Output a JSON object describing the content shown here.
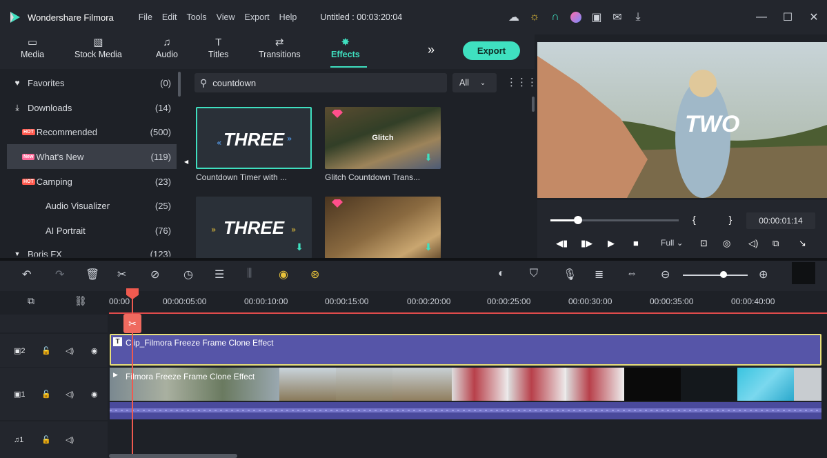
{
  "app": {
    "name": "Wondershare Filmora",
    "menu": [
      "File",
      "Edit",
      "Tools",
      "View",
      "Export",
      "Help"
    ],
    "project": "Untitled : 00:03:20:04"
  },
  "titlebar_icons": [
    "cloud-icon",
    "bulb-icon",
    "headset-icon",
    "avatar-icon",
    "save-icon",
    "mail-icon",
    "download-icon"
  ],
  "window_controls": {
    "minimize": "—",
    "maximize": "☐",
    "close": "✕"
  },
  "toolbar": {
    "tabs": [
      {
        "label": "Media",
        "icon": "folder-icon"
      },
      {
        "label": "Stock Media",
        "icon": "stock-icon"
      },
      {
        "label": "Audio",
        "icon": "music-icon"
      },
      {
        "label": "Titles",
        "icon": "text-icon"
      },
      {
        "label": "Transitions",
        "icon": "transition-icon"
      },
      {
        "label": "Effects",
        "icon": "effects-icon"
      }
    ],
    "active_tab": "Effects",
    "more": "»",
    "export_label": "Export",
    "accent": "#3fe0c0"
  },
  "sidebar": {
    "items": [
      {
        "label": "Favorites",
        "count": "(0)",
        "icon": "heart-icon",
        "badge": ""
      },
      {
        "label": "Downloads",
        "count": "(14)",
        "icon": "download-icon",
        "badge": ""
      },
      {
        "label": "Recommended",
        "count": "(500)",
        "icon": "",
        "badge": "HOT"
      },
      {
        "label": "What's New",
        "count": "(119)",
        "icon": "",
        "badge": "New"
      },
      {
        "label": "Camping",
        "count": "(23)",
        "icon": "",
        "badge": "HOT"
      },
      {
        "label": "Audio Visualizer",
        "count": "(25)",
        "icon": "",
        "badge": ""
      },
      {
        "label": "AI Portrait",
        "count": "(76)",
        "icon": "",
        "badge": ""
      },
      {
        "label": "Boris FX",
        "count": "(123)",
        "icon": "caret-down-icon",
        "badge": ""
      }
    ],
    "selected": "What's New"
  },
  "search": {
    "value": "countdown",
    "filter": "All"
  },
  "effects": [
    {
      "label": "Countdown Timer with ...",
      "thumb_text": "THREE"
    },
    {
      "label": "Glitch Countdown Trans...",
      "thumb_text": "Glitch"
    },
    {
      "label": "",
      "thumb_text": "THREE"
    },
    {
      "label": "",
      "thumb_text": ""
    }
  ],
  "preview": {
    "overlay_text": "TWO",
    "braces": "{   }",
    "timecode": "00:00:01:14",
    "quality": "Full",
    "progress": 0.22
  },
  "timeline": {
    "ruler": [
      "00:00",
      "00:00:05:00",
      "00:00:10:00",
      "00:00:15:00",
      "00:00:20:00",
      "00:00:25:00",
      "00:00:30:00",
      "00:00:35:00",
      "00:00:40:00"
    ],
    "tracks": [
      {
        "id": "2",
        "type": "video"
      },
      {
        "id": "1",
        "type": "video"
      },
      {
        "id": "1",
        "type": "audio"
      }
    ],
    "clips": {
      "title_clip": "Clip_Filmora Freeze Frame Clone Effect",
      "video_clip": "Filmora Freeze Frame Clone Effect"
    }
  }
}
